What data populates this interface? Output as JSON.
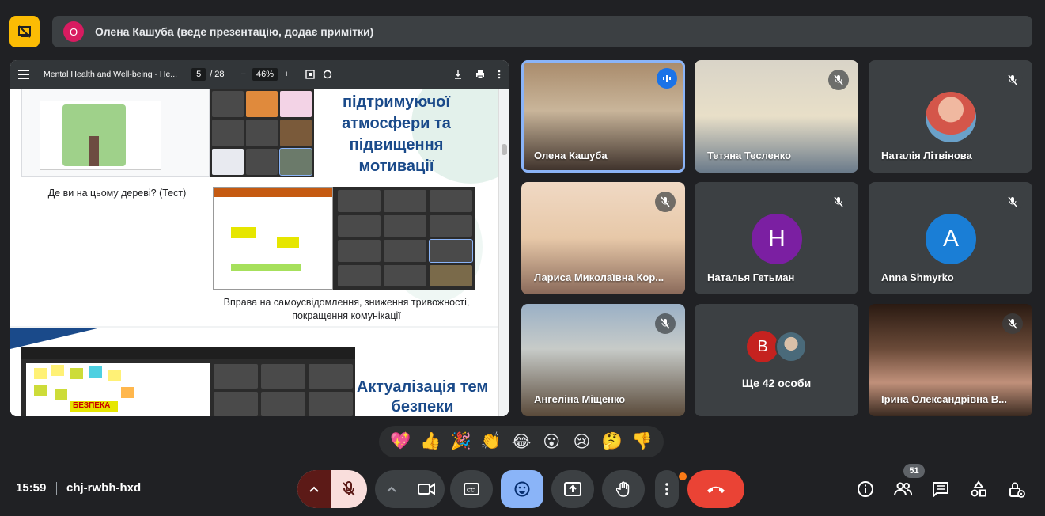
{
  "presenter": {
    "avatar_letter": "О",
    "text": "Олена Кашуба (веде презентацію, додає примітки)"
  },
  "pdf": {
    "title": "Mental Health and Well-being - He...",
    "page_current": "5",
    "page_total": "/ 28",
    "zoom": "46%"
  },
  "slide1": {
    "title_lines": [
      "підтримуючої",
      "атмосфери та",
      "підвищення",
      "мотивації"
    ],
    "caption_tree": "Де ви на цьому дереві? (Тест)",
    "caption_exercise": "Вправа на самоусвідомлення, зниження тривожності, покращення комунікації"
  },
  "slide2": {
    "title": "Актуалізація тем безпеки",
    "sticky_word": "БЕЗПЕКА"
  },
  "tiles": [
    {
      "name": "Олена Кашуба"
    },
    {
      "name": "Тетяна Тесленко"
    },
    {
      "name": "Наталія Літвінова"
    },
    {
      "name": "Лариса Миколаївна Кор..."
    },
    {
      "name": "Наталья Гетьман",
      "letter": "Н",
      "color": "#7b1fa2"
    },
    {
      "name": "Anna Shmyrko",
      "letter": "A",
      "color": "#1a7ed6"
    },
    {
      "name": "Ангеліна Міщенко"
    },
    {
      "more_label": "Ще 42 особи",
      "letter": "В"
    },
    {
      "name": "Ірина Олександрівна В..."
    }
  ],
  "reactions": [
    "💖",
    "👍",
    "🎉",
    "👏",
    "😂",
    "😮",
    "😢",
    "🤔",
    "👎"
  ],
  "meeting": {
    "time": "15:59",
    "code": "chj-rwbh-hxd",
    "participants_count": "51"
  },
  "colors": {
    "accent": "#8ab4f8",
    "leave": "#ea4335",
    "muted_bg": "#f9dedc",
    "present_badge": "#fbbc04"
  }
}
